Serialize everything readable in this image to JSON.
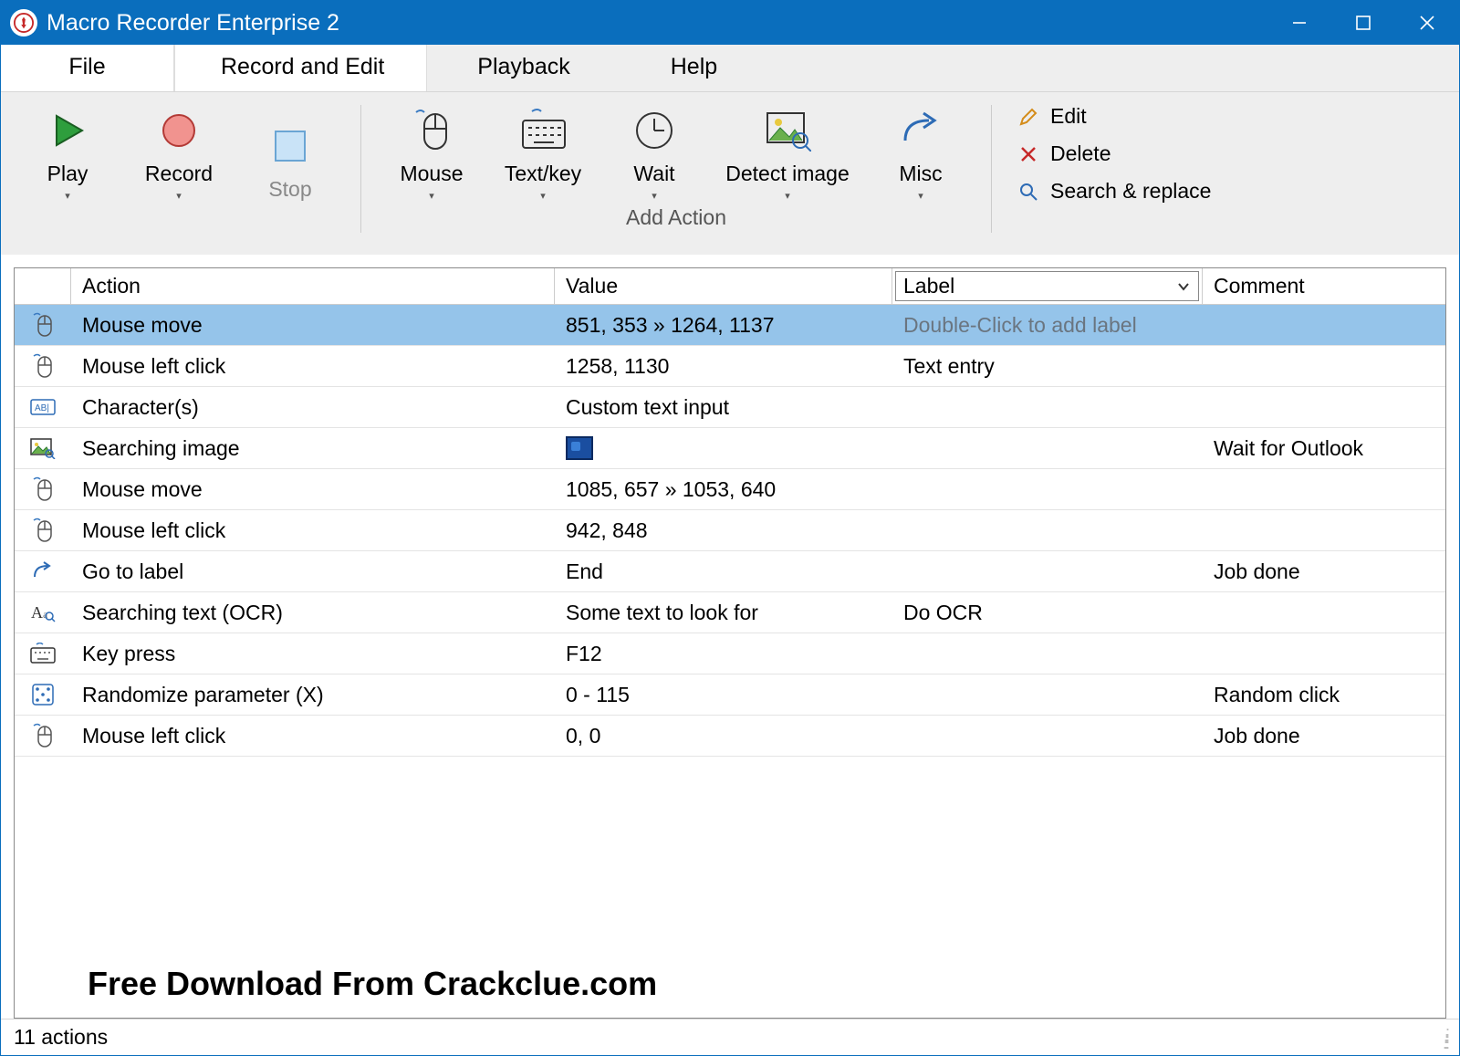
{
  "title": "Macro Recorder Enterprise 2",
  "menu": {
    "file": "File",
    "record_edit": "Record and Edit",
    "playback": "Playback",
    "help": "Help"
  },
  "ribbon": {
    "play": "Play",
    "record": "Record",
    "stop": "Stop",
    "mouse": "Mouse",
    "textkey": "Text/key",
    "wait": "Wait",
    "detect": "Detect image",
    "misc": "Misc",
    "add_action_caption": "Add Action",
    "edit": "Edit",
    "delete": "Delete",
    "search_replace": "Search & replace"
  },
  "columns": {
    "action": "Action",
    "value": "Value",
    "label": "Label",
    "comment": "Comment"
  },
  "rows": [
    {
      "icon": "mouse-move",
      "action": "Mouse move",
      "value": "851, 353 » 1264, 1137",
      "label": "Double-Click to add label",
      "comment": "",
      "selected": true
    },
    {
      "icon": "mouse-click",
      "action": "Mouse left click",
      "value": "1258, 1130",
      "label": "Text entry",
      "comment": ""
    },
    {
      "icon": "characters",
      "action": "Character(s)",
      "value": "Custom text input",
      "label": "",
      "comment": ""
    },
    {
      "icon": "image-search",
      "action": "Searching image",
      "value": "__CHIP__",
      "label": "",
      "comment": "Wait for Outlook"
    },
    {
      "icon": "mouse-move",
      "action": "Mouse move",
      "value": "1085, 657 » 1053, 640",
      "label": "",
      "comment": ""
    },
    {
      "icon": "mouse-click",
      "action": "Mouse left click",
      "value": "942, 848",
      "label": "",
      "comment": ""
    },
    {
      "icon": "goto",
      "action": "Go to label",
      "value": "End",
      "label": "",
      "comment": "Job done"
    },
    {
      "icon": "ocr",
      "action": "Searching text (OCR)",
      "value": "Some text to look for",
      "label": "Do OCR",
      "comment": ""
    },
    {
      "icon": "keyboard",
      "action": "Key press",
      "value": "F12",
      "label": "",
      "comment": ""
    },
    {
      "icon": "random",
      "action": "Randomize parameter (X)",
      "value": "0 - 115",
      "label": "",
      "comment": "Random click"
    },
    {
      "icon": "mouse-click",
      "action": "Mouse left click",
      "value": "0, 0",
      "label": "",
      "comment": "Job done"
    }
  ],
  "watermark": "Free Download From Crackclue.com",
  "status": "11 actions"
}
